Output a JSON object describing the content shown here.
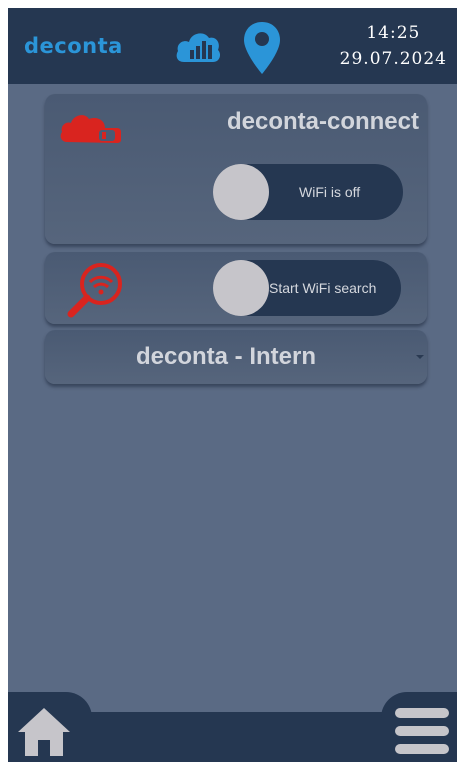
{
  "header": {
    "logo": "deconta",
    "cloud_icon": "cloud-signal-icon",
    "location_icon": "location-pin-icon",
    "time": "14:25",
    "date": "29.07.2024"
  },
  "connect_panel": {
    "icon": "wifi-icon",
    "title": "deconta-connect",
    "wifi_toggle_label": "WiFi is off",
    "wifi_enabled": false
  },
  "search_panel": {
    "icon": "wifi-search-icon",
    "toggle_label": "Start WiFi search",
    "search_enabled": false
  },
  "network_select": {
    "selected": "deconta - Intern"
  },
  "bottom_nav": {
    "home_icon": "home-icon",
    "menu_icon": "menu-icon"
  },
  "colors": {
    "background": "#5a6a84",
    "bar": "#253751",
    "brand_blue": "#2b95d8",
    "accent_red": "#d9241f",
    "knob": "#c6c5ca"
  }
}
